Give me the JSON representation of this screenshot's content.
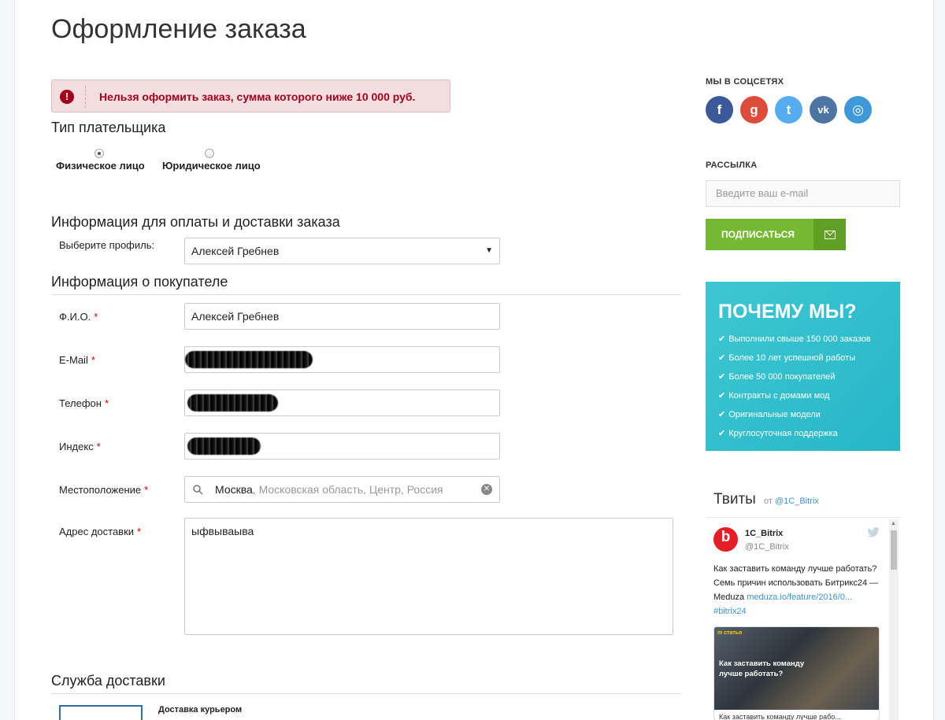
{
  "page": {
    "title": "Оформление заказа"
  },
  "alert": {
    "icon": "!",
    "message": "Нельзя оформить заказ, сумма которого ниже 10 000 руб."
  },
  "payer": {
    "heading": "Тип плательщика",
    "options": [
      {
        "label": "Физическое лицо",
        "selected": true
      },
      {
        "label": "Юридическое лицо",
        "selected": false
      }
    ]
  },
  "payment_info": {
    "heading": "Информация для оплаты и доставки заказа",
    "profile_label": "Выберите профиль:",
    "profile_value": "Алексей Гребнев",
    "arrow": "▼"
  },
  "buyer": {
    "heading": "Информация о покупателе",
    "required_mark": "*",
    "fields": {
      "fio": {
        "label": "Ф.И.О.",
        "value": "Алексей Гребнев"
      },
      "email": {
        "label": "E-Mail"
      },
      "phone": {
        "label": "Телефон"
      },
      "index": {
        "label": "Индекс"
      },
      "location": {
        "label": "Местоположение",
        "city": "Москва",
        "rest": ", Московская область, Центр, Россия"
      },
      "address": {
        "label": "Адрес доставки",
        "value": "ыфвываыва"
      }
    }
  },
  "delivery": {
    "heading": "Служба доставки",
    "option": "Доставка курьером"
  },
  "sidebar": {
    "social_heading": "МЫ В СОЦСЕТЯХ",
    "social": [
      {
        "name": "facebook",
        "glyph": "f",
        "color": "#3b5998"
      },
      {
        "name": "google-plus",
        "glyph": "g",
        "color": "#dd4b39"
      },
      {
        "name": "twitter",
        "glyph": "t",
        "color": "#55acee"
      },
      {
        "name": "vk",
        "glyph": "vk",
        "color": "#4c75a3"
      },
      {
        "name": "instagram",
        "glyph": "◎",
        "color": "#3f99d8"
      }
    ],
    "newsletter_heading": "РАССЫЛКА",
    "email_placeholder": "Введите ваш e-mail",
    "subscribe_label": "ПОДПИСАТЬСЯ",
    "why": {
      "title": "ПОЧЕМУ МЫ?",
      "check": "✔",
      "items": [
        "Выполнили свыше 150 000 заказов",
        "Более 10 лет успешной работы",
        "Более 50 000 покупателей",
        "Контракты с домами мод",
        "Оригинальные модели",
        "Круглосуточная поддержка"
      ]
    },
    "tweets": {
      "title": "Твиты",
      "from_prefix": "от",
      "from_handle": "@1C_Bitrix",
      "author": "1C_Bitrix",
      "handle": "@1C_Bitrix",
      "text": "Как заставить команду лучше работать? Семь причин использовать Битрикс24 — Meduza",
      "link": "meduza.io/feature/2016/0...",
      "hashtag": "#bitrix24",
      "card_brand": "m статья",
      "card_caption": "Как заставить команду лучше работать?",
      "card_bottom": "Как заставить команду лучше рабо..."
    }
  }
}
